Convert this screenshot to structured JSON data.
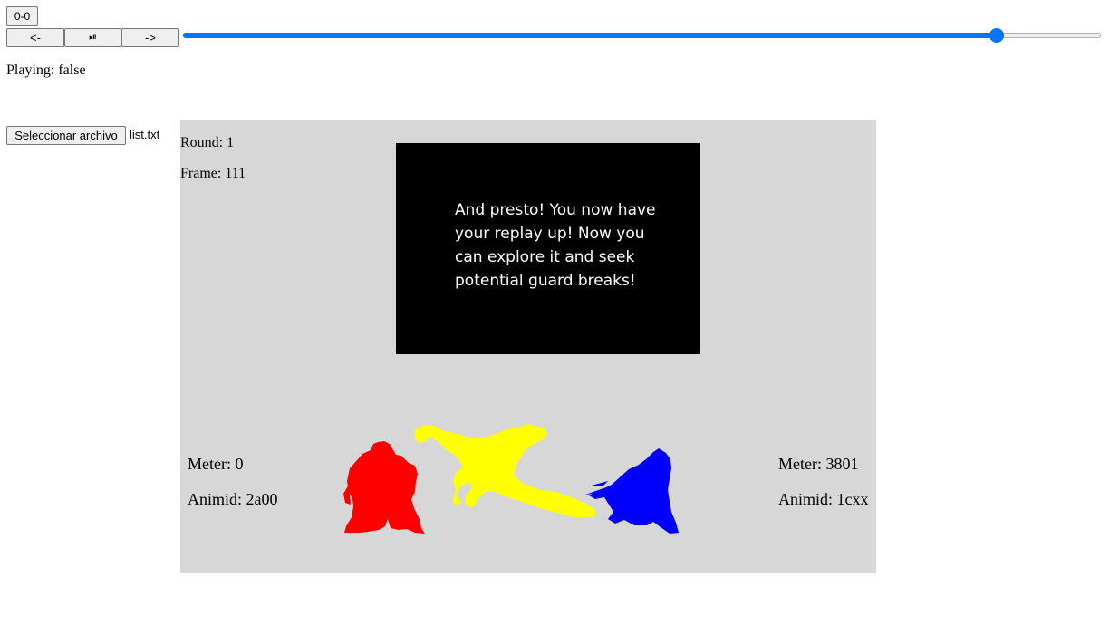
{
  "controls": {
    "counter_label": "0-0",
    "prev_label": "<-",
    "playpause_label": "⏯",
    "next_label": "->",
    "timeline": {
      "value_fraction": 0.893
    }
  },
  "status": {
    "playing_text": "Playing: false"
  },
  "file": {
    "button_label": "Seleccionar archivo",
    "file_name": "list.txt"
  },
  "stage": {
    "background": "#d7d7d7",
    "round_text": "Round: 1",
    "frame_text": "Frame: 111",
    "message": "And presto! You now have your replay up! Now you can explore it and seek potential guard breaks!",
    "player1": {
      "meter_text": "Meter: 0",
      "animid_text": "Animid: 2a00",
      "color": "#ff0000"
    },
    "player2": {
      "meter_text": "Meter: 3801",
      "animid_text": "Animid: 1cxx",
      "color": "#0000ff"
    },
    "assist": {
      "color": "#ffff00"
    }
  },
  "colors": {
    "accent": "#0075ff"
  }
}
